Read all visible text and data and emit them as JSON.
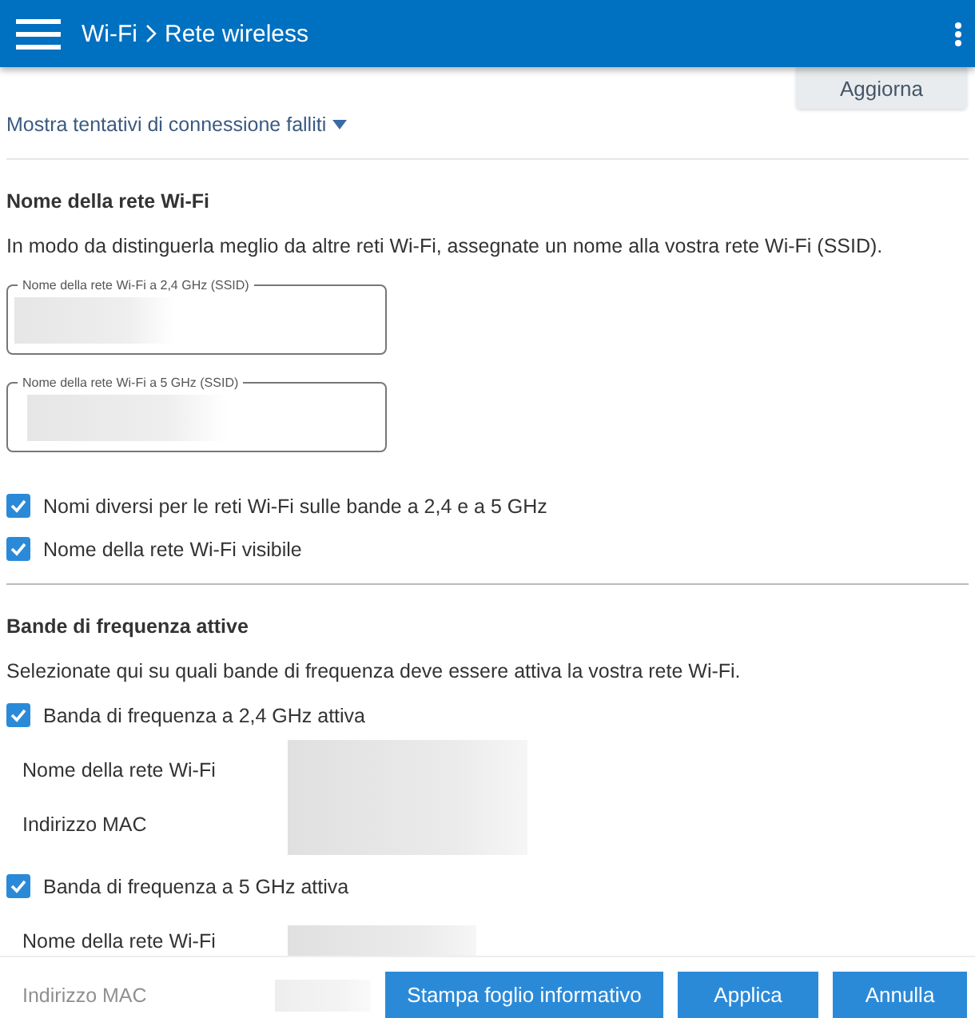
{
  "header": {
    "breadcrumb": [
      "Wi-Fi",
      "Rete wireless"
    ]
  },
  "refresh_button": "Aggiorna",
  "failed_attempts_link": "Mostra tentativi di connessione falliti",
  "ssid_section": {
    "title": "Nome della rete Wi-Fi",
    "description": "In modo da distinguerla meglio da altre reti Wi-Fi, assegnate un nome alla vostra rete Wi-Fi (SSID).",
    "fields": [
      {
        "label": "Nome della rete Wi-Fi a 2,4 GHz (SSID)"
      },
      {
        "label": "Nome della rete Wi-Fi a 5 GHz (SSID)"
      }
    ],
    "options": [
      {
        "label": "Nomi diversi per le reti Wi-Fi sulle bande a 2,4 e a 5 GHz",
        "checked": true
      },
      {
        "label": "Nome della rete Wi-Fi visibile",
        "checked": true
      }
    ]
  },
  "bands_section": {
    "title": "Bande di frequenza attive",
    "description": "Selezionate qui su quali bande di frequenza deve essere attiva la vostra rete Wi-Fi.",
    "bands": [
      {
        "label": "Banda di frequenza a 2,4 GHz attiva",
        "checked": true,
        "rows": [
          "Nome della rete Wi-Fi",
          "Indirizzo MAC"
        ]
      },
      {
        "label": "Banda di frequenza a 5 GHz attiva",
        "checked": true,
        "rows": [
          "Nome della rete Wi-Fi",
          "Indirizzo MAC"
        ]
      }
    ]
  },
  "footer_buttons": [
    "Stampa foglio informativo",
    "Applica",
    "Annulla"
  ]
}
